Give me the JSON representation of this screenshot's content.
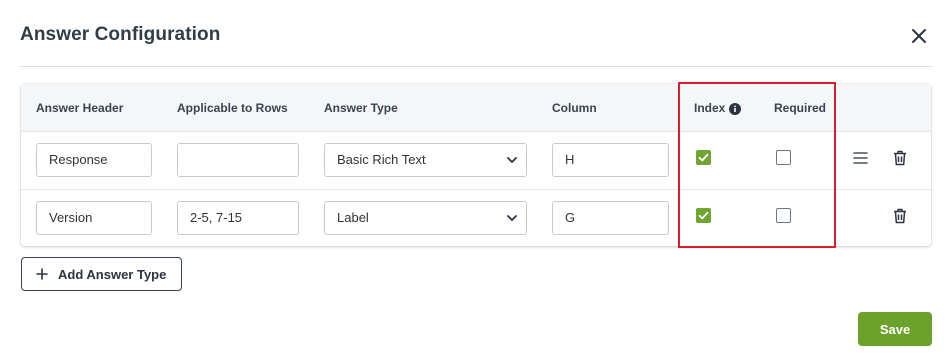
{
  "modal": {
    "title": "Answer Configuration"
  },
  "table": {
    "headers": {
      "answer_header": "Answer Header",
      "applicable_rows": "Applicable to Rows",
      "answer_type": "Answer Type",
      "column": "Column",
      "index": "Index",
      "required": "Required"
    },
    "rows": [
      {
        "answer_header": "Response",
        "applicable_rows": "",
        "answer_type": "Basic Rich Text",
        "column": "H",
        "index": true,
        "required": false,
        "has_reorder_handle": true
      },
      {
        "answer_header": "Version",
        "applicable_rows": "2-5, 7-15",
        "answer_type": "Label",
        "column": "G",
        "index": true,
        "required": false,
        "has_reorder_handle": false
      }
    ]
  },
  "actions": {
    "add_answer_type": "Add Answer Type",
    "save": "Save"
  },
  "colors": {
    "accent_green": "#6ca12b",
    "highlight_red": "#d9202a"
  },
  "icons": {
    "close": "close-icon",
    "info": "info-icon",
    "chevron": "chevron-down-icon",
    "drag": "drag-handle-icon",
    "trash": "trash-icon",
    "plus": "plus-icon",
    "check": "checkmark-icon"
  }
}
